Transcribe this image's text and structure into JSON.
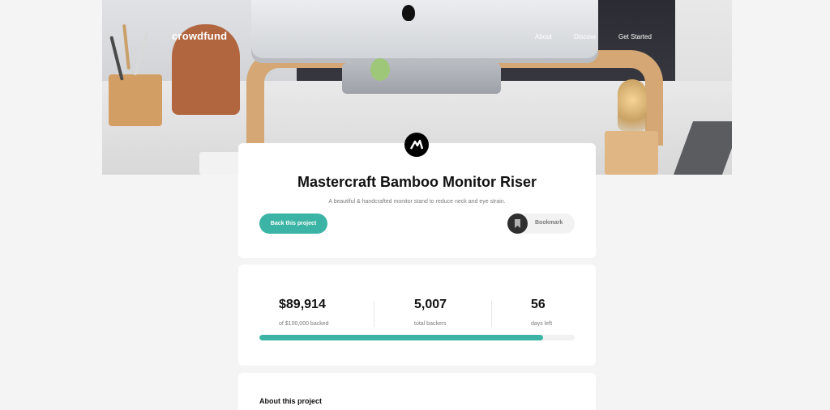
{
  "header": {
    "logo": "crowdfund",
    "nav": [
      "About",
      "Discover",
      "Get Started"
    ]
  },
  "project": {
    "title": "Mastercraft Bamboo Monitor Riser",
    "description": "A beautiful & handcrafted monitor stand to reduce neck and eye strain.",
    "back_button": "Back this project",
    "bookmark_label": "Bookmark"
  },
  "stats": {
    "backed_value": "$89,914",
    "backed_label": "of $100,000 backed",
    "backers_value": "5,007",
    "backers_label": "total backers",
    "days_value": "56",
    "days_label": "days left",
    "progress_fraction": 0.89914
  },
  "about": {
    "title": "About this project"
  },
  "colors": {
    "accent": "#3cb4a5",
    "card_bg": "#ffffff",
    "page_bg": "#f4f4f4"
  },
  "icons": {
    "logo_mark": "mastercraft-logo-icon",
    "bookmark": "bookmark-icon"
  }
}
